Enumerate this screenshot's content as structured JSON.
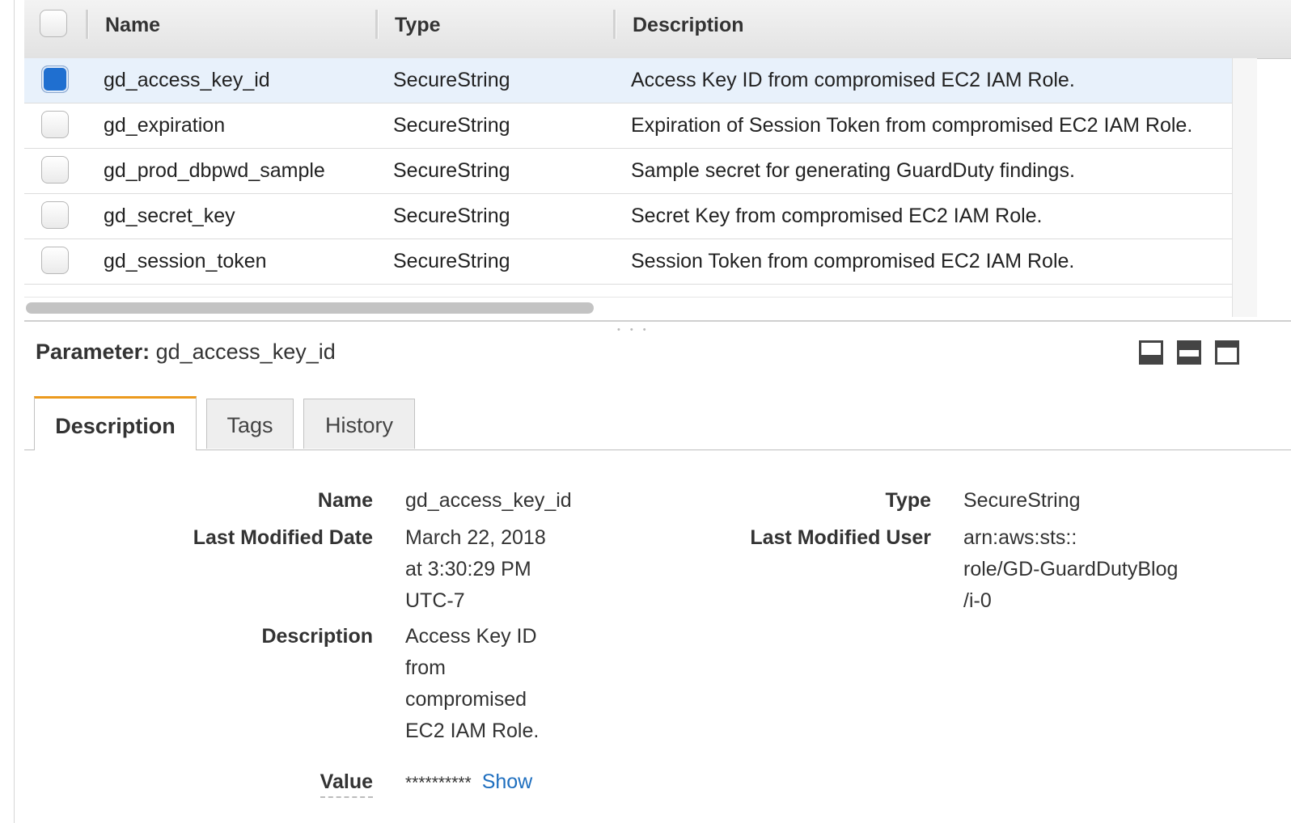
{
  "table": {
    "headers": {
      "name": "Name",
      "type": "Type",
      "description": "Description"
    },
    "rows": [
      {
        "name": "gd_access_key_id",
        "type": "SecureString",
        "description": "Access Key ID from compromised EC2 IAM Role.",
        "selected": true
      },
      {
        "name": "gd_expiration",
        "type": "SecureString",
        "description": "Expiration of Session Token from compromised EC2 IAM Role.",
        "selected": false
      },
      {
        "name": "gd_prod_dbpwd_sample",
        "type": "SecureString",
        "description": "Sample secret for generating GuardDuty findings.",
        "selected": false
      },
      {
        "name": "gd_secret_key",
        "type": "SecureString",
        "description": "Secret Key from compromised EC2 IAM Role.",
        "selected": false
      },
      {
        "name": "gd_session_token",
        "type": "SecureString",
        "description": "Session Token from compromised EC2 IAM Role.",
        "selected": false
      }
    ]
  },
  "detail": {
    "title_prefix": "Parameter:",
    "title_value": "gd_access_key_id",
    "tabs": [
      "Description",
      "Tags",
      "History"
    ],
    "active_tab": "Description",
    "fields": {
      "name_label": "Name",
      "name_value": "gd_access_key_id",
      "type_label": "Type",
      "type_value": "SecureString",
      "last_modified_date_label": "Last Modified Date",
      "last_modified_date_lines": [
        "March 22, 2018",
        "at 3:30:29 PM",
        "UTC-7"
      ],
      "last_modified_user_label": "Last Modified User",
      "last_modified_user_lines": [
        "arn:aws:sts::",
        "role/GD-GuardDutyBlog",
        "/i-0"
      ],
      "description_label": "Description",
      "description_lines": [
        "Access Key ID",
        "from",
        "compromised",
        "EC2 IAM Role."
      ],
      "value_label": "Value",
      "value_masked": "**********",
      "show_link": "Show"
    }
  },
  "colors": {
    "accent_tab": "#ec9a1e",
    "checkbox_selected": "#1f6fd0",
    "row_selected": "#e8f1fb",
    "link": "#1f6fbf"
  }
}
